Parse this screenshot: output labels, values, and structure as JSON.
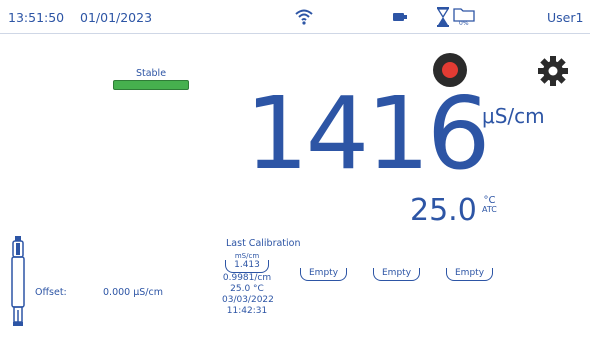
{
  "topbar": {
    "time": "13:51:50",
    "date": "01/01/2023",
    "user": "User1",
    "storage_text": "0%",
    "icons": [
      "wifi-icon",
      "battery-icon",
      "hourglass-icon",
      "folder-icon"
    ]
  },
  "status": {
    "stable_label": "Stable",
    "stable_color": "#46b04e"
  },
  "measurement": {
    "value": "1416",
    "unit": "μS/cm"
  },
  "temperature": {
    "value": "25.0",
    "unit": "°C",
    "mode": "ATC"
  },
  "offset": {
    "label": "Offset:",
    "value": "0.000 μS/cm"
  },
  "calibration": {
    "title": "Last Calibration",
    "point_unit": "mS/cm",
    "point_value": "1.413",
    "cell_constant": "0.9981/cm",
    "temperature": "25.0 °C",
    "date": "03/03/2022",
    "time": "11:42:31",
    "empty_slots": [
      "Empty",
      "Empty",
      "Empty"
    ]
  },
  "colors": {
    "text": "#2d55a5",
    "record": "#e23b33",
    "stable": "#46b04e"
  }
}
